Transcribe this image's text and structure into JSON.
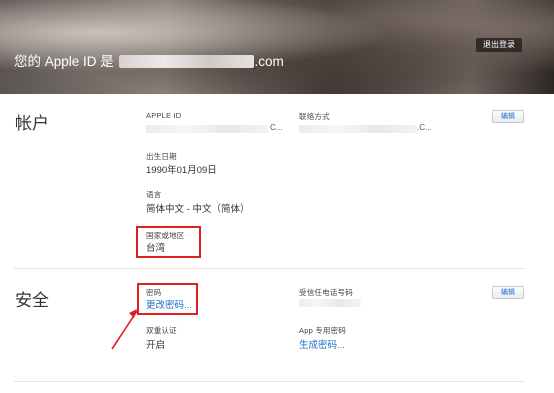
{
  "hero": {
    "prefix": "您的 Apple ID 是",
    "suffix": ".com",
    "signout_label": "退出登录"
  },
  "account": {
    "title": "帐户",
    "edit_label": "编辑",
    "apple_id": {
      "label": "APPLE ID",
      "tail": "C..."
    },
    "contact": {
      "label": "联络方式",
      "tail": ".C..."
    },
    "birthday": {
      "label": "出生日期",
      "value": "1990年01月09日"
    },
    "language": {
      "label": "语言",
      "value": "简体中文 - 中文（简体）"
    },
    "region": {
      "label": "国家或地区",
      "value": "台湾"
    }
  },
  "security": {
    "title": "安全",
    "edit_label": "编辑",
    "password": {
      "label": "密码",
      "link": "更改密码..."
    },
    "trusted_phone": {
      "label": "受信任电话号码"
    },
    "two_factor": {
      "label": "双重认证",
      "value": "开启"
    },
    "app_password": {
      "label": "App 专用密码",
      "link": "生成密码..."
    }
  },
  "annotation_color": "#e02020"
}
